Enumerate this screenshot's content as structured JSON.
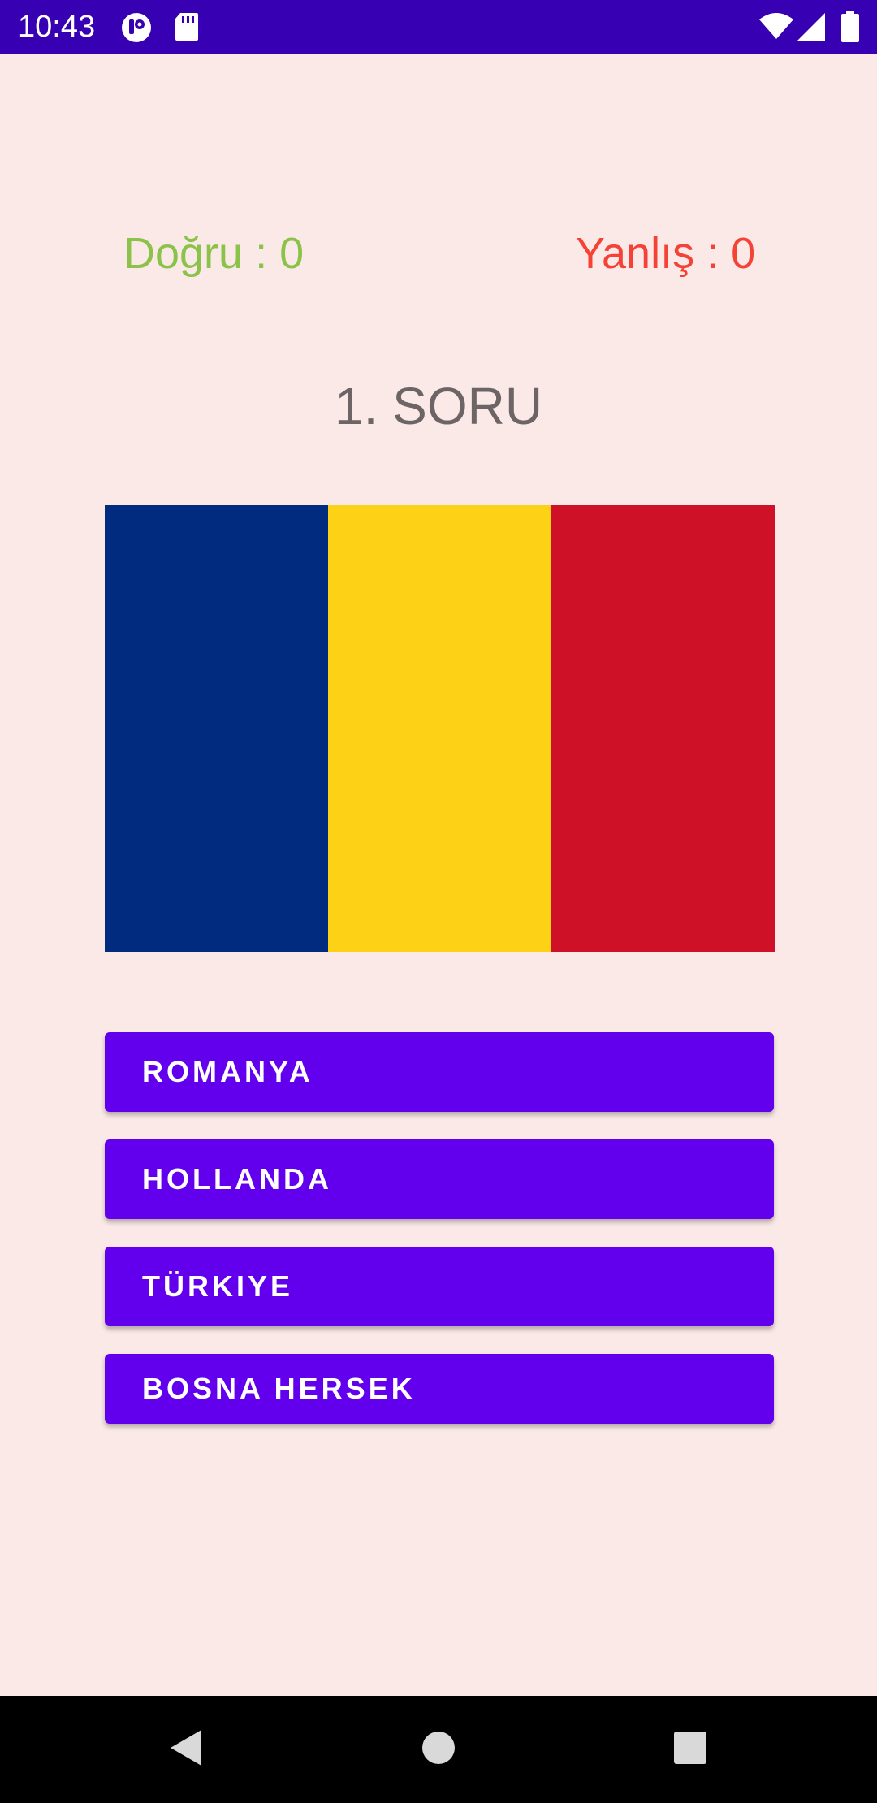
{
  "status_bar": {
    "time": "10:43",
    "icons_left": [
      "app-notification-icon",
      "sd-card-icon"
    ],
    "icons_right": [
      "wifi-icon",
      "cellular-signal-icon",
      "battery-icon"
    ],
    "background_color": "#3700B3"
  },
  "score": {
    "correct_label": "Doğru : 0",
    "correct_color": "#8BC34A",
    "wrong_label": "Yanlış : 0",
    "wrong_color": "#F44336"
  },
  "question": {
    "title": "1. SORU"
  },
  "flag": {
    "stripes": [
      "#002B7F",
      "#FCD116",
      "#CE1126"
    ]
  },
  "answers": [
    {
      "label": "ROMANYA"
    },
    {
      "label": "HOLLANDA"
    },
    {
      "label": "TÜRKIYE"
    },
    {
      "label": "BOSNA HERSEK"
    }
  ],
  "button_color": "#6200EE",
  "page_background": "#FBE9E7",
  "nav_bar": {
    "icons": [
      "back-icon",
      "home-icon",
      "recents-icon"
    ]
  }
}
